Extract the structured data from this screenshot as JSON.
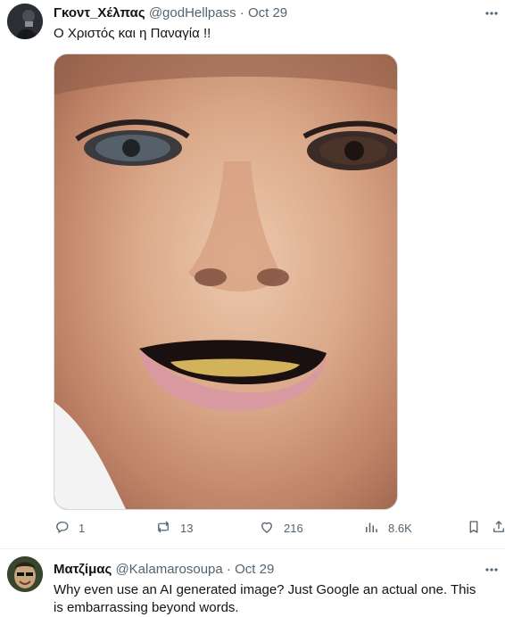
{
  "tweets": [
    {
      "display_name": "Γκοντ_Χέλπας",
      "handle": "@godHellpass",
      "separator": "·",
      "date": "Oct 29",
      "text": "Ο Χριστός και η Παναγία !!",
      "actions": {
        "replies": "1",
        "retweets": "13",
        "likes": "216",
        "views": "8.6K"
      }
    },
    {
      "display_name": "Ματζίμας",
      "handle": "@Kalamarosoupa",
      "separator": "·",
      "date": "Oct 29",
      "text": "Why even use an AI generated image? Just Google an actual one. This is embarrassing beyond words."
    }
  ],
  "icons": {
    "more": "more-icon",
    "reply": "reply-icon",
    "retweet": "retweet-icon",
    "like": "heart-icon",
    "views": "views-icon",
    "bookmark": "bookmark-icon",
    "share": "share-icon"
  },
  "colors": {
    "text": "#0f1419",
    "muted": "#536471",
    "border": "#cfd9de"
  }
}
